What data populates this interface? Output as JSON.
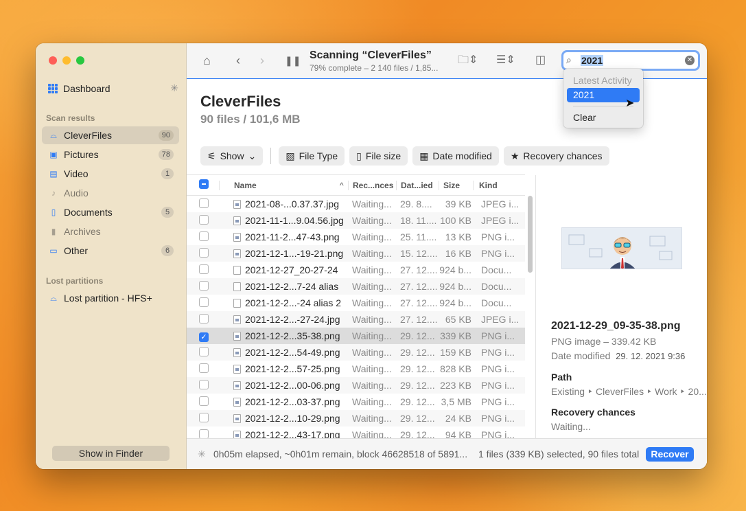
{
  "sidebar": {
    "dashboard": "Dashboard",
    "scan_results_label": "Scan results",
    "items": [
      {
        "label": "CleverFiles",
        "count": "90",
        "icon": "drive-icon"
      },
      {
        "label": "Pictures",
        "count": "78",
        "icon": "picture-icon"
      },
      {
        "label": "Video",
        "count": "1",
        "icon": "video-icon"
      },
      {
        "label": "Audio",
        "count": "",
        "icon": "music-icon"
      },
      {
        "label": "Documents",
        "count": "5",
        "icon": "document-icon"
      },
      {
        "label": "Archives",
        "count": "",
        "icon": "archive-icon"
      },
      {
        "label": "Other",
        "count": "6",
        "icon": "file-icon"
      }
    ],
    "lost_label": "Lost partitions",
    "lost_item": "Lost partition - HFS+",
    "finder_button": "Show in Finder"
  },
  "toolbar": {
    "title": "Scanning “CleverFiles”",
    "subtitle": "79% complete – 2 140 files / 1,85...",
    "progress": 0.79
  },
  "search": {
    "value": "2021",
    "dropdown_header": "Latest Activity",
    "dropdown_selected": "2021",
    "dropdown_clear": "Clear"
  },
  "heading": {
    "title": "CleverFiles",
    "subtitle": "90 files / 101,6 MB"
  },
  "filters": {
    "show": "Show",
    "file_type": "File Type",
    "file_size": "File size",
    "date_modified": "Date modified",
    "recovery_chances": "Recovery chances"
  },
  "table": {
    "headers": {
      "name": "Name",
      "recovery": "Rec...nces",
      "date": "Dat...ied",
      "size": "Size",
      "kind": "Kind"
    },
    "rows": [
      {
        "name": "2021-08-...0.37.37.jpg",
        "rec": "Waiting...",
        "date": "29. 8....",
        "size": "39 KB",
        "kind": "JPEG i...",
        "img": true,
        "checked": false
      },
      {
        "name": "2021-11-1...9.04.56.jpg",
        "rec": "Waiting...",
        "date": "18. 11....",
        "size": "100 KB",
        "kind": "JPEG i...",
        "img": true,
        "checked": false
      },
      {
        "name": "2021-11-2...47-43.png",
        "rec": "Waiting...",
        "date": "25. 11....",
        "size": "13 KB",
        "kind": "PNG i...",
        "img": true,
        "checked": false
      },
      {
        "name": "2021-12-1...-19-21.png",
        "rec": "Waiting...",
        "date": "15. 12....",
        "size": "16 KB",
        "kind": "PNG i...",
        "img": true,
        "checked": false
      },
      {
        "name": "2021-12-27_20-27-24",
        "rec": "Waiting...",
        "date": "27. 12....",
        "size": "924 b...",
        "kind": "Docu...",
        "img": false,
        "checked": false
      },
      {
        "name": "2021-12-2...7-24 alias",
        "rec": "Waiting...",
        "date": "27. 12....",
        "size": "924 b...",
        "kind": "Docu...",
        "img": false,
        "checked": false
      },
      {
        "name": "2021-12-2...-24 alias 2",
        "rec": "Waiting...",
        "date": "27. 12....",
        "size": "924 b...",
        "kind": "Docu...",
        "img": false,
        "checked": false
      },
      {
        "name": "2021-12-2...-27-24.jpg",
        "rec": "Waiting...",
        "date": "27. 12....",
        "size": "65 KB",
        "kind": "JPEG i...",
        "img": true,
        "checked": false
      },
      {
        "name": "2021-12-2...35-38.png",
        "rec": "Waiting...",
        "date": "29. 12...",
        "size": "339 KB",
        "kind": "PNG i...",
        "img": true,
        "checked": true
      },
      {
        "name": "2021-12-2...54-49.png",
        "rec": "Waiting...",
        "date": "29. 12...",
        "size": "159 KB",
        "kind": "PNG i...",
        "img": true,
        "checked": false
      },
      {
        "name": "2021-12-2...57-25.png",
        "rec": "Waiting...",
        "date": "29. 12...",
        "size": "828 KB",
        "kind": "PNG i...",
        "img": true,
        "checked": false
      },
      {
        "name": "2021-12-2...00-06.png",
        "rec": "Waiting...",
        "date": "29. 12...",
        "size": "223 KB",
        "kind": "PNG i...",
        "img": true,
        "checked": false
      },
      {
        "name": "2021-12-2...03-37.png",
        "rec": "Waiting...",
        "date": "29. 12...",
        "size": "3,5 MB",
        "kind": "PNG i...",
        "img": true,
        "checked": false
      },
      {
        "name": "2021-12-2...10-29.png",
        "rec": "Waiting...",
        "date": "29. 12...",
        "size": "24 KB",
        "kind": "PNG i...",
        "img": true,
        "checked": false
      },
      {
        "name": "2021-12-2...43-17.png",
        "rec": "Waiting...",
        "date": "29. 12...",
        "size": "94 KB",
        "kind": "PNG i...",
        "img": true,
        "checked": false
      }
    ]
  },
  "detail": {
    "filename": "2021-12-29_09-35-38.png",
    "kind": "PNG image – 339.42 KB",
    "date_label": "Date modified",
    "date_value": "29. 12. 2021 9:36",
    "path_label": "Path",
    "path_value": "Existing ‣ CleverFiles ‣ Work ‣ 20...",
    "recovery_label": "Recovery chances",
    "recovery_value": "Waiting..."
  },
  "status": {
    "elapsed": "0h05m elapsed, ~0h01m remain, block 46628518 of 5891...",
    "selection": "1 files (339 KB) selected, 90 files total",
    "recover": "Recover"
  },
  "colors": {
    "accent": "#2f7bf5",
    "sidebar": "#efe3c9"
  }
}
